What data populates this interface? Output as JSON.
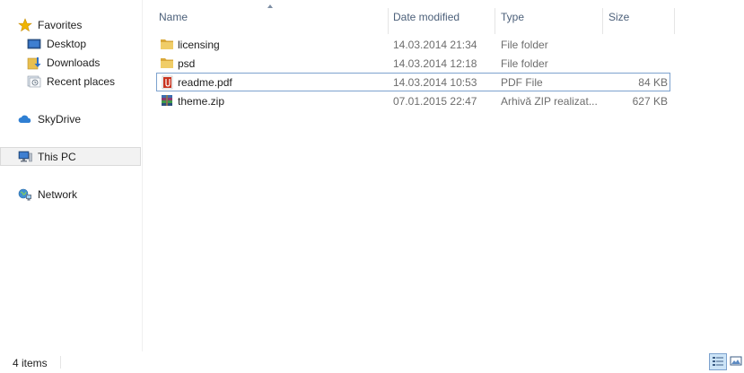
{
  "nav": {
    "favorites": {
      "label": "Favorites",
      "icon": "star-icon",
      "color": "#f0b400"
    },
    "desktop": {
      "label": "Desktop",
      "icon": "desktop-icon"
    },
    "downloads": {
      "label": "Downloads",
      "icon": "downloads-icon"
    },
    "recent": {
      "label": "Recent places",
      "icon": "recent-places-icon"
    },
    "skydrive": {
      "label": "SkyDrive",
      "icon": "cloud-icon"
    },
    "thispc": {
      "label": "This PC",
      "icon": "computer-icon"
    },
    "network": {
      "label": "Network",
      "icon": "network-icon"
    }
  },
  "columns": {
    "name": "Name",
    "date": "Date modified",
    "type": "Type",
    "size": "Size"
  },
  "files": [
    {
      "name": "licensing",
      "date": "14.03.2014 21:34",
      "type": "File folder",
      "size": "",
      "icon": "folder-icon"
    },
    {
      "name": "psd",
      "date": "14.03.2014 12:18",
      "type": "File folder",
      "size": "",
      "icon": "folder-icon"
    },
    {
      "name": "readme.pdf",
      "date": "14.03.2014 10:53",
      "type": "PDF File",
      "size": "84 KB",
      "icon": "pdf-icon"
    },
    {
      "name": "theme.zip",
      "date": "07.01.2015 22:47",
      "type": "Arhivă ZIP realizat...",
      "size": "627 KB",
      "icon": "zip-archive-icon"
    }
  ],
  "status": {
    "count": "4 items"
  },
  "colors": {
    "accent": "#7da2ce",
    "header_text": "#4c607a",
    "folder": "#e8bf4f"
  }
}
